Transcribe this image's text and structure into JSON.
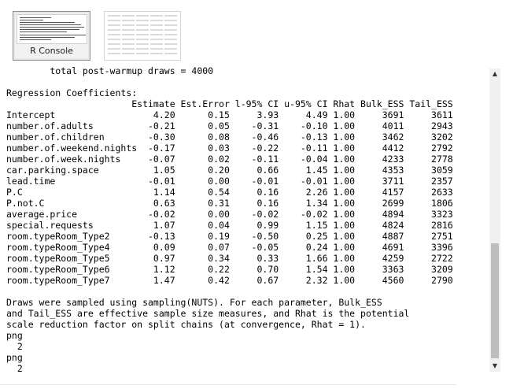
{
  "tabs": [
    {
      "label": "R Console",
      "active": true
    },
    {
      "label": "",
      "active": false
    }
  ],
  "console": {
    "lines": [
      "        total post-warmup draws = 4000",
      "",
      "Regression Coefficients:",
      "                       Estimate Est.Error l-95% CI u-95% CI Rhat Bulk_ESS Tail_ESS",
      "Intercept                  4.20      0.15     3.93     4.49 1.00     3691     3611",
      "number.of.adults          -0.21      0.05    -0.31    -0.10 1.00     4011     2943",
      "number.of.children        -0.30      0.08    -0.46    -0.13 1.00     3462     3202",
      "number.of.weekend.nights  -0.17      0.03    -0.22    -0.11 1.00     4412     2792",
      "number.of.week.nights     -0.07      0.02    -0.11    -0.04 1.00     4233     2778",
      "car.parking.space          1.05      0.20     0.66     1.45 1.00     4353     3059",
      "lead.time                 -0.01      0.00    -0.01    -0.01 1.00     3711     2357",
      "P.C                        1.14      0.54     0.16     2.26 1.00     4157     2633",
      "P.not.C                    0.63      0.31     0.16     1.34 1.00     2699     1806",
      "average.price             -0.02      0.00    -0.02    -0.02 1.00     4894     3323",
      "special.requests           1.07      0.04     0.99     1.15 1.00     4824     2816",
      "room.typeRoom_Type2       -0.13      0.19    -0.50     0.25 1.00     4887     2751",
      "room.typeRoom_Type4        0.09      0.07    -0.05     0.24 1.00     4691     3396",
      "room.typeRoom_Type5        0.97      0.34     0.33     1.66 1.00     4259     2722",
      "room.typeRoom_Type6        1.12      0.22     0.70     1.54 1.00     3363     3209",
      "room.typeRoom_Type7        1.47      0.42     0.67     2.32 1.00     4560     2790",
      "",
      "Draws were sampled using sampling(NUTS). For each parameter, Bulk_ESS",
      "and Tail_ESS are effective sample size measures, and Rhat is the potential",
      "scale reduction factor on split chains (at convergence, Rhat = 1).",
      "png ",
      "  2 ",
      "png ",
      "  2 "
    ]
  },
  "scrollbar": {
    "up_icon": "triangle-up",
    "down_icon": "triangle-down"
  }
}
